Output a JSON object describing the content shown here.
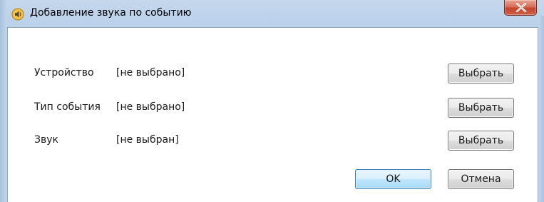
{
  "window": {
    "title": "Добавление звука по событию",
    "title_icon": "speaker-icon",
    "close_icon": "close-icon"
  },
  "rows": [
    {
      "label": "Устройство",
      "value": "[не выбрано]",
      "button": "Выбрать"
    },
    {
      "label": "Тип события",
      "value": "[не выбрано]",
      "button": "Выбрать"
    },
    {
      "label": "Звук",
      "value": "[не выбран]",
      "button": "Выбрать"
    }
  ],
  "footer": {
    "ok_label": "OK",
    "cancel_label": "Отмена"
  },
  "colors": {
    "titlebar": "#bcd2ea",
    "close_button": "#c4452b",
    "default_button_border": "#3c7fb1"
  }
}
